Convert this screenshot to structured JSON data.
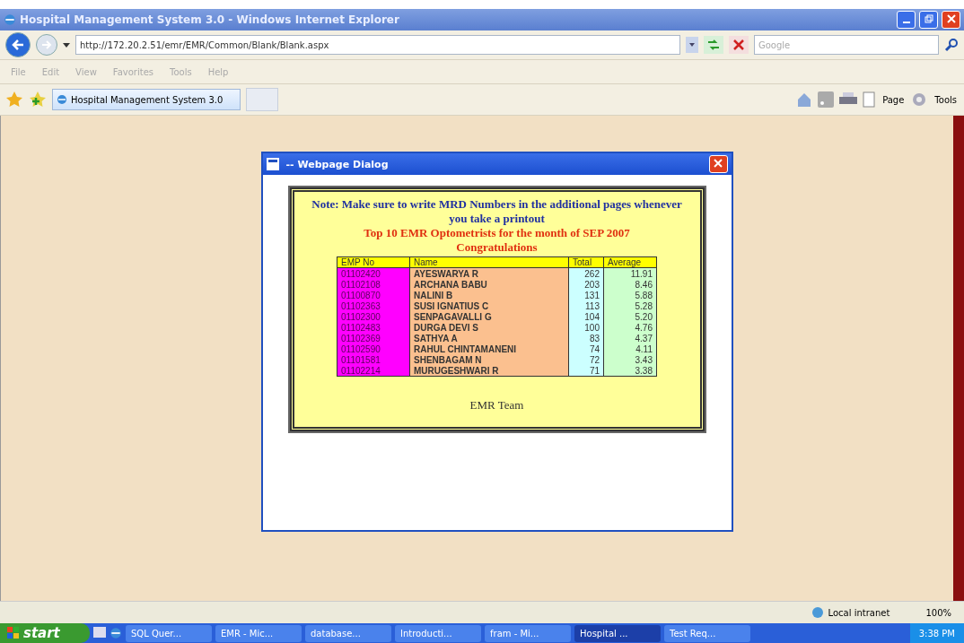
{
  "window": {
    "title": "Hospital Management System 3.0 - Windows Internet Explorer"
  },
  "address_bar": {
    "url": "http://172.20.2.51/emr/EMR/Common/Blank/Blank.aspx"
  },
  "search": {
    "placeholder": "Google"
  },
  "menu": [
    "File",
    "Edit",
    "View",
    "Favorites",
    "Tools",
    "Help"
  ],
  "tab": {
    "label": "Hospital Management System 3.0",
    "selected": true
  },
  "command_bar": [
    "Page",
    "Tools"
  ],
  "dialog": {
    "title": "-- Webpage Dialog",
    "note": "Note: Make sure to write MRD Numbers in the additional pages whenever you take a printout",
    "heading": "Top 10 EMR Optometrists for the month of SEP 2007",
    "subheading": "Congratulations",
    "signature": "EMR Team",
    "table": {
      "columns": [
        "EMP No",
        "Name",
        "Total",
        "Average"
      ],
      "rows": [
        [
          "01102420",
          "AYESWARYA R",
          "262",
          "11.91"
        ],
        [
          "01102108",
          "ARCHANA BABU",
          "203",
          "8.46"
        ],
        [
          "01100870",
          "NALINI B",
          "131",
          "5.88"
        ],
        [
          "01102363",
          "SUSI IGNATIUS C",
          "113",
          "5.28"
        ],
        [
          "01102300",
          "SENPAGAVALLI G",
          "104",
          "5.20"
        ],
        [
          "01102483",
          "DURGA DEVI S",
          "100",
          "4.76"
        ],
        [
          "01102369",
          "SATHYA A",
          "83",
          "4.37"
        ],
        [
          "01102590",
          "RAHUL CHINTAMANENI",
          "74",
          "4.11"
        ],
        [
          "01101581",
          "SHENBAGAM N",
          "72",
          "3.43"
        ],
        [
          "01102214",
          "MURUGESHWARI R",
          "71",
          "3.38"
        ]
      ]
    }
  },
  "status_bar": {
    "zone": "Local intranet",
    "zoom": "100%"
  },
  "taskbar": {
    "start": "start",
    "items": [
      {
        "label": "SQL Quer...",
        "selected": false
      },
      {
        "label": "EMR - Mic...",
        "selected": false
      },
      {
        "label": "database...",
        "selected": false
      },
      {
        "label": "Introducti...",
        "selected": false
      },
      {
        "label": "fram - Mi...",
        "selected": false
      },
      {
        "label": "Hospital ...",
        "selected": true
      },
      {
        "label": "Test Req...",
        "selected": false
      }
    ],
    "clock": "3:38 PM"
  }
}
